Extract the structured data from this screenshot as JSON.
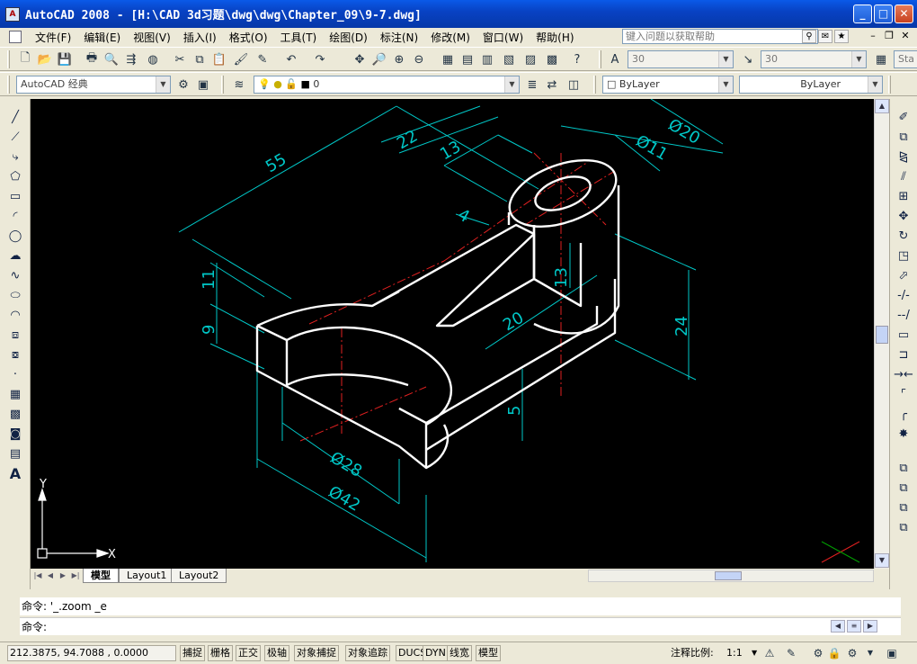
{
  "window": {
    "title": "AutoCAD 2008 - [H:\\CAD  3d习题\\dwg\\dwg\\Chapter_09\\9-7.dwg]",
    "app_icon": "autocad-logo-icon",
    "controls": [
      "minimize-icon",
      "maximize-icon",
      "close-icon"
    ]
  },
  "menubar": {
    "items": [
      "文件(F)",
      "编辑(E)",
      "视图(V)",
      "插入(I)",
      "格式(O)",
      "工具(T)",
      "绘图(D)",
      "标注(N)",
      "修改(M)",
      "窗口(W)",
      "帮助(H)"
    ],
    "help_placeholder": "键入问题以获取帮助"
  },
  "toolbar_standard": {
    "textstyle_value": "30",
    "dimstyle_value": "30",
    "partial_label": "Sta"
  },
  "toolbar_row2": {
    "workspace": "AutoCAD 经典",
    "layer": "0",
    "color": "ByLayer",
    "linetype": "ByLayer"
  },
  "drawing": {
    "dimensions": [
      "55",
      "22",
      "13",
      "Ø20",
      "Ø11",
      "4",
      "11",
      "9",
      "13",
      "20",
      "24",
      "5",
      "Ø28",
      "Ø42"
    ],
    "ucs_y": "Y",
    "ucs_x": "X",
    "colors": {
      "background": "#000000",
      "object": "#ffffff",
      "dimension": "#00c8c8",
      "centerline": "#e02020"
    }
  },
  "layout_tabs": [
    "模型",
    "Layout1",
    "Layout2"
  ],
  "command": {
    "history": "命令: '_.zoom _e",
    "prompt": "命令:"
  },
  "status": {
    "coords": "212.3875, 94.7088 , 0.0000",
    "toggles": [
      "捕捉",
      "栅格",
      "正交",
      "极轴",
      "对象捕捉",
      "对象追踪",
      "DUCS",
      "DYN",
      "线宽",
      "模型"
    ],
    "annotation_scale_label": "注释比例:",
    "annotation_scale_value": "1:1"
  }
}
